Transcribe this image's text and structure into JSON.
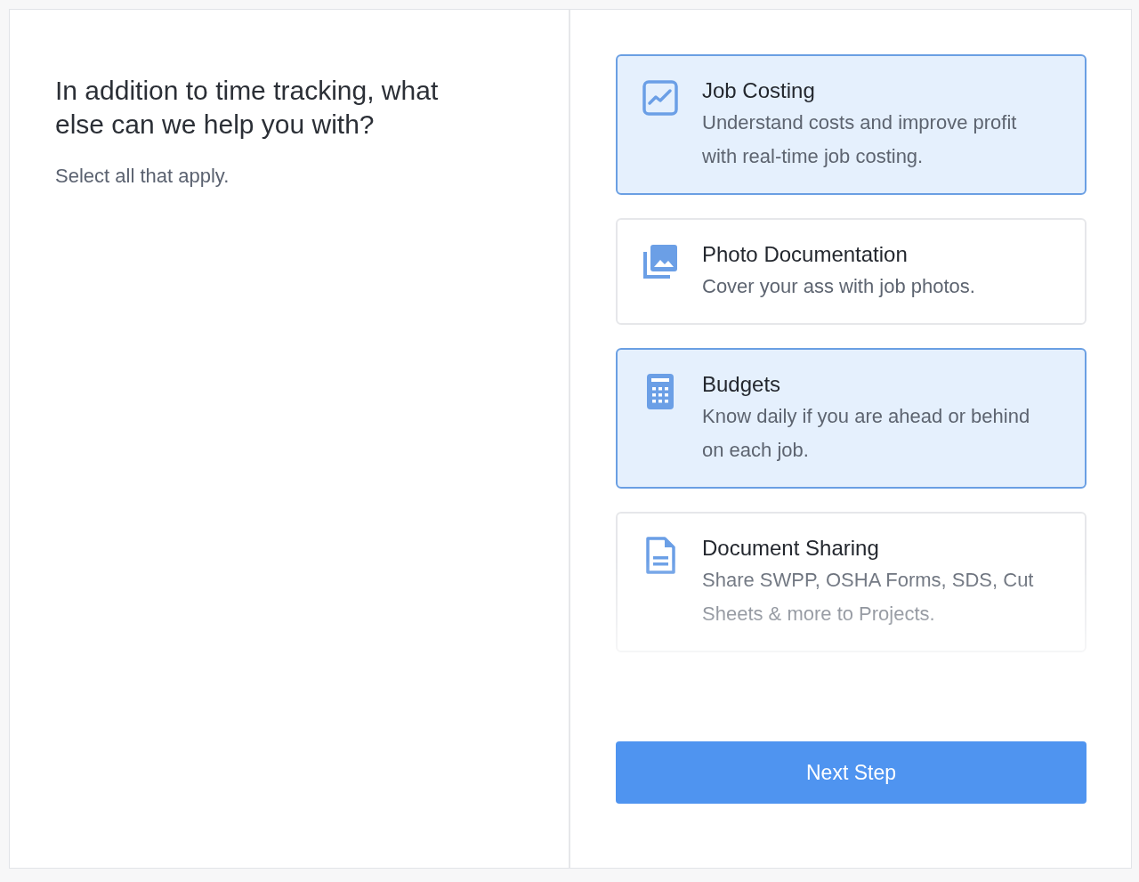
{
  "question": {
    "title": "In addition to time tracking, what else can we help you with?",
    "hint": "Select all that apply."
  },
  "options": [
    {
      "kind": "chart",
      "title": "Job Costing",
      "description": "Understand costs and improve profit with real-time job costing.",
      "selected": true
    },
    {
      "kind": "photos",
      "title": "Photo Documentation",
      "description": "Cover your ass with job photos.",
      "selected": false
    },
    {
      "kind": "calculator",
      "title": "Budgets",
      "description": "Know daily if you are ahead or behind on each job.",
      "selected": true
    },
    {
      "kind": "document",
      "title": "Document Sharing",
      "description": "Share SWPP, OSHA Forms, SDS, Cut Sheets & more to Projects.",
      "selected": false
    }
  ],
  "next_button": "Next Step"
}
